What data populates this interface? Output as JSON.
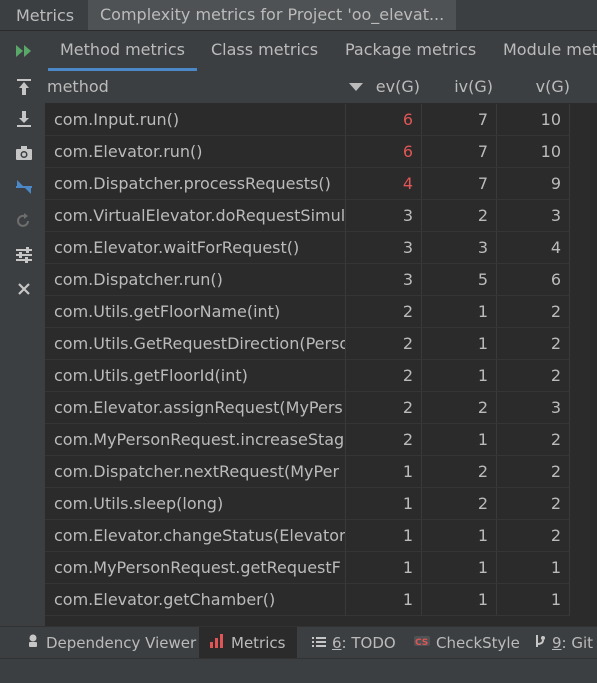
{
  "window": {
    "panel_title": "Metrics",
    "tab_title": "Complexity metrics for Project 'oo_elevat..."
  },
  "tabs": [
    {
      "label": "Method metrics",
      "active": true
    },
    {
      "label": "Class metrics",
      "active": false
    },
    {
      "label": "Package metrics",
      "active": false
    },
    {
      "label": "Module metr",
      "active": false
    }
  ],
  "toolbar_icons": [
    "run-icon",
    "export-top-icon",
    "download-icon",
    "camera-icon",
    "compare-arrows-icon",
    "redo-icon",
    "settings-sliders-icon",
    "close-icon"
  ],
  "table": {
    "columns": [
      "method",
      "ev(G)",
      "iv(G)",
      "v(G)"
    ],
    "rows": [
      {
        "method": "com.Input.run()",
        "ev": "6",
        "iv": "7",
        "v": "10",
        "ev_red": true
      },
      {
        "method": "com.Elevator.run()",
        "ev": "6",
        "iv": "7",
        "v": "10",
        "ev_red": true
      },
      {
        "method": "com.Dispatcher.processRequests()",
        "ev": "4",
        "iv": "7",
        "v": "9",
        "ev_red": true
      },
      {
        "method": "com.VirtualElevator.doRequestSimul",
        "ev": "3",
        "iv": "2",
        "v": "3",
        "ev_red": false
      },
      {
        "method": "com.Elevator.waitForRequest()",
        "ev": "3",
        "iv": "3",
        "v": "4",
        "ev_red": false
      },
      {
        "method": "com.Dispatcher.run()",
        "ev": "3",
        "iv": "5",
        "v": "6",
        "ev_red": false
      },
      {
        "method": "com.Utils.getFloorName(int)",
        "ev": "2",
        "iv": "1",
        "v": "2",
        "ev_red": false
      },
      {
        "method": "com.Utils.GetRequestDirection(Perso",
        "ev": "2",
        "iv": "1",
        "v": "2",
        "ev_red": false
      },
      {
        "method": "com.Utils.getFloorId(int)",
        "ev": "2",
        "iv": "1",
        "v": "2",
        "ev_red": false
      },
      {
        "method": "com.Elevator.assignRequest(MyPers",
        "ev": "2",
        "iv": "2",
        "v": "3",
        "ev_red": false
      },
      {
        "method": "com.MyPersonRequest.increaseStag",
        "ev": "2",
        "iv": "1",
        "v": "2",
        "ev_red": false
      },
      {
        "method": "com.Dispatcher.nextRequest(MyPer",
        "ev": "1",
        "iv": "2",
        "v": "2",
        "ev_red": false
      },
      {
        "method": "com.Utils.sleep(long)",
        "ev": "1",
        "iv": "2",
        "v": "2",
        "ev_red": false
      },
      {
        "method": "com.Elevator.changeStatus(Elevator",
        "ev": "1",
        "iv": "1",
        "v": "2",
        "ev_red": false
      },
      {
        "method": "com.MyPersonRequest.getRequestF",
        "ev": "1",
        "iv": "1",
        "v": "1",
        "ev_red": false
      },
      {
        "method": "com.Elevator.getChamber()",
        "ev": "1",
        "iv": "1",
        "v": "1",
        "ev_red": false
      }
    ]
  },
  "bottom_tabs": [
    {
      "label": "Dependency Viewer",
      "icon": "dependency-icon",
      "active": false
    },
    {
      "label": "Metrics",
      "icon": "metrics-bar-icon",
      "active": true
    },
    {
      "prefix": "6",
      "label": ": TODO",
      "icon": "todo-list-icon",
      "active": false
    },
    {
      "label": "CheckStyle",
      "icon": "checkstyle-icon",
      "active": false
    },
    {
      "prefix": "9",
      "label": ": Git",
      "icon": "git-icon",
      "active": false
    }
  ],
  "colors": {
    "red_value": "#e05555",
    "accent": "#4a88c7",
    "run_green": "#59a869"
  }
}
